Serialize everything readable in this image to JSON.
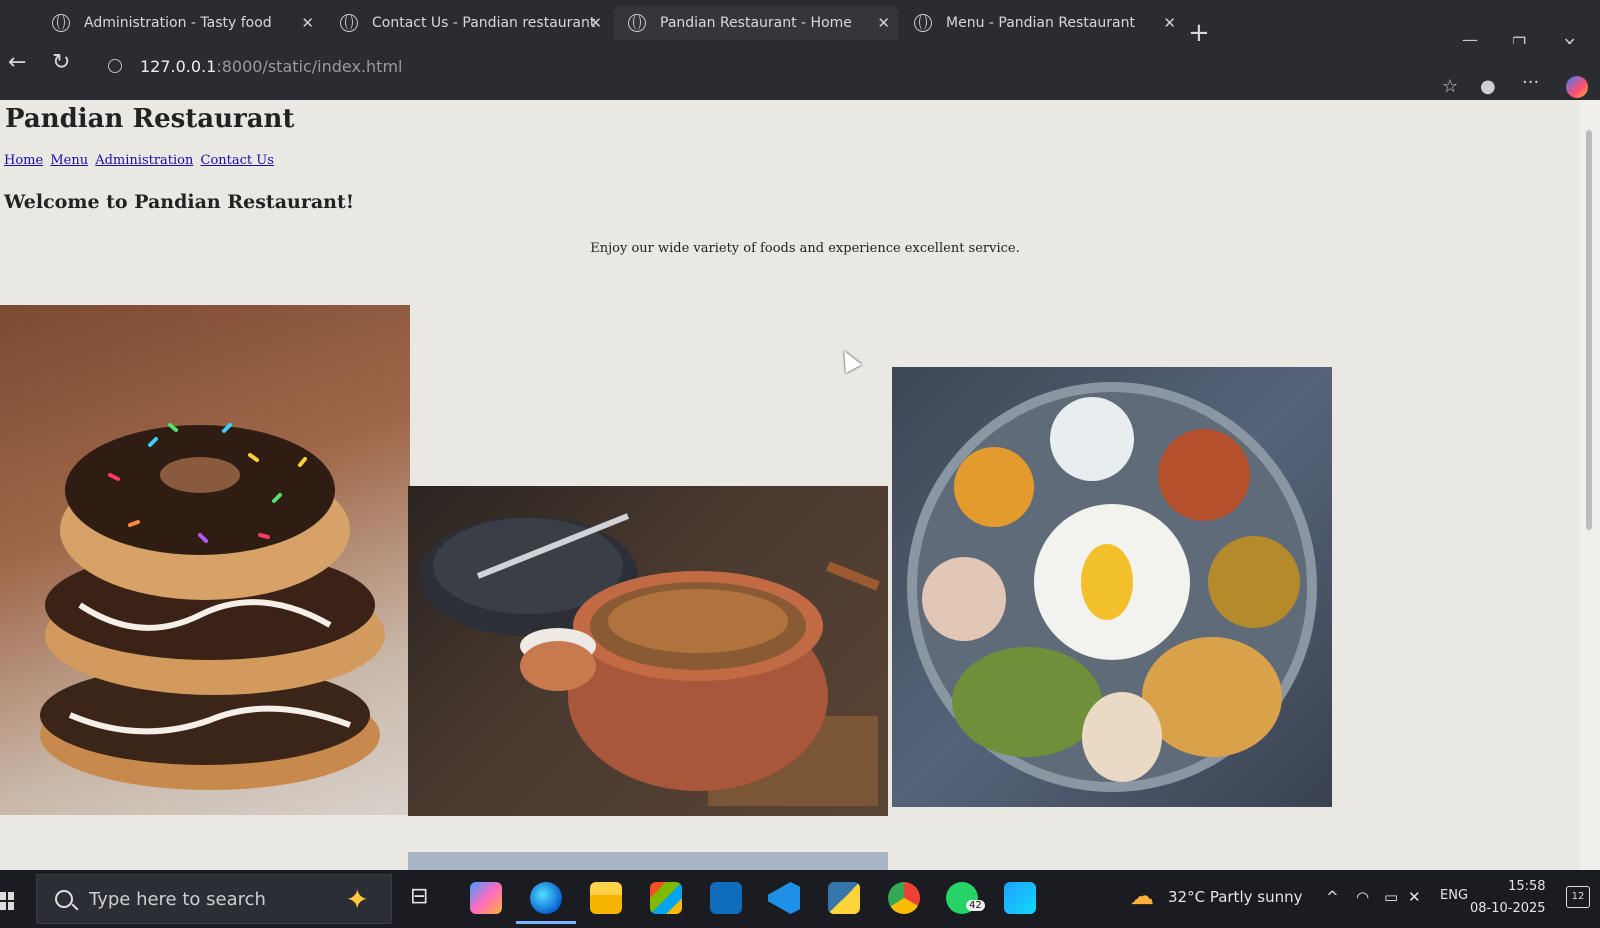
{
  "browser": {
    "tabs": [
      {
        "title": "Administration - Tasty food"
      },
      {
        "title": "Contact Us - Pandian restaurant"
      },
      {
        "title": "Pandian Restaurant - Home"
      },
      {
        "title": "Menu - Pandian Restaurant"
      }
    ],
    "address": {
      "host": "127.0.0.1",
      "rest": ":8000/static/index.html"
    }
  },
  "page": {
    "heading": "Pandian Restaurant",
    "nav": [
      {
        "label": "Home"
      },
      {
        "label": "Menu"
      },
      {
        "label": "Administration"
      },
      {
        "label": "Contact Us"
      }
    ],
    "welcome": "Welcome to Pandian Restaurant!",
    "tagline": "Enjoy our wide variety of foods and experience excellent service."
  },
  "taskbar": {
    "search_placeholder": "Type here to search",
    "weather": "32°C  Partly sunny",
    "language": "ENG",
    "time": "15:58",
    "date": "08-10-2025",
    "whatsapp_badge": "42",
    "notification_count": "12"
  }
}
